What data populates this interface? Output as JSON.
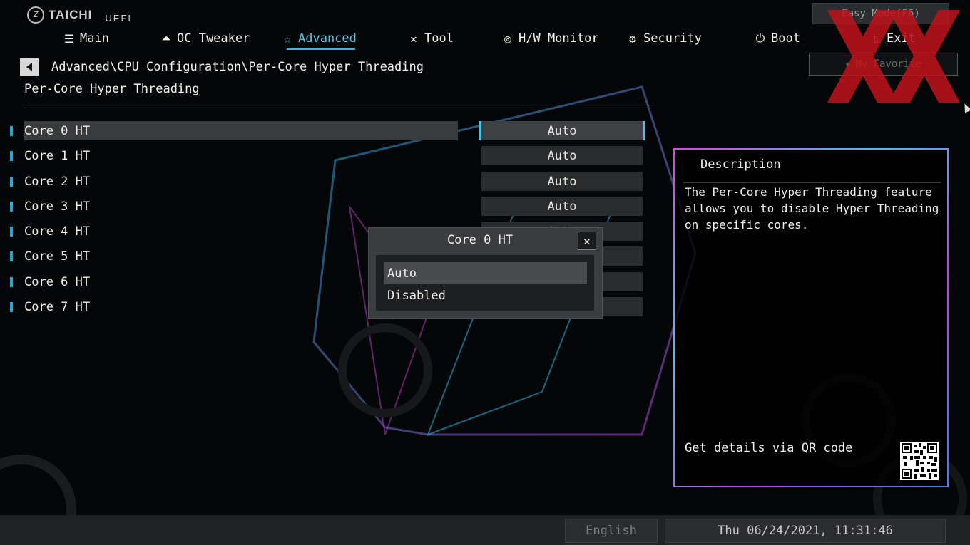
{
  "brand": {
    "name": "TAICHI",
    "sub": "UEFI"
  },
  "nav": [
    {
      "label": "Main",
      "icon": "list-icon"
    },
    {
      "label": "OC Tweaker",
      "icon": "rocket-icon"
    },
    {
      "label": "Advanced",
      "icon": "star-icon",
      "active": true
    },
    {
      "label": "Tool",
      "icon": "tools-icon"
    },
    {
      "label": "H/W Monitor",
      "icon": "monitor-icon"
    },
    {
      "label": "Security",
      "icon": "shield-icon"
    },
    {
      "label": "Boot",
      "icon": "power-icon"
    },
    {
      "label": "Exit",
      "icon": "exit-icon"
    }
  ],
  "easy_mode": "Easy Mode(F6)",
  "my_favorite": "My Favorite",
  "breadcrumb": "Advanced\\CPU Configuration\\Per-Core Hyper Threading",
  "page_title": "Per-Core Hyper Threading",
  "settings": [
    {
      "label": "Core 0 HT",
      "value": "Auto"
    },
    {
      "label": "Core 1 HT",
      "value": "Auto"
    },
    {
      "label": "Core 2 HT",
      "value": "Auto"
    },
    {
      "label": "Core 3 HT",
      "value": "Auto"
    },
    {
      "label": "Core 4 HT",
      "value": "Auto"
    },
    {
      "label": "Core 5 HT",
      "value": "Auto"
    },
    {
      "label": "Core 6 HT",
      "value": "Auto"
    },
    {
      "label": "Core 7 HT",
      "value": "Auto"
    }
  ],
  "description": {
    "title": "Description",
    "text": "The Per-Core Hyper Threading feature allows you to disable Hyper Threading on specific cores.",
    "qr_label": "Get details via QR code"
  },
  "dialog": {
    "title": "Core 0 HT",
    "options": [
      "Auto",
      "Disabled"
    ],
    "selected": "Auto"
  },
  "status": {
    "language": "English",
    "datetime": "Thu 06/24/2021, 11:31:46"
  },
  "colors": {
    "accent": "#3fb3d6",
    "watermark": "#c0141b"
  }
}
